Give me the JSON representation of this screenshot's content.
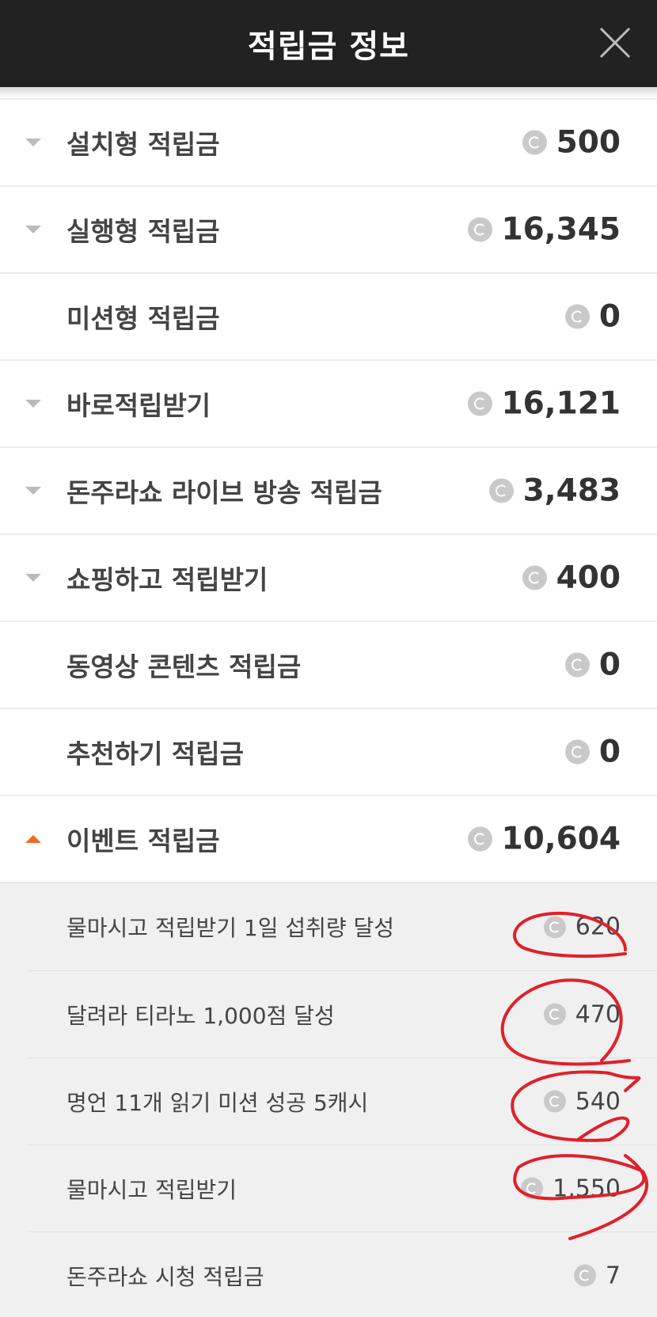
{
  "header": {
    "title": "적립금 정보",
    "close_icon": "close-icon"
  },
  "rows": [
    {
      "label": "설치형 적립금",
      "value": "500",
      "arrow": "down"
    },
    {
      "label": "실행형 적립금",
      "value": "16,345",
      "arrow": "down"
    },
    {
      "label": "미션형 적립금",
      "value": "0",
      "arrow": "none"
    },
    {
      "label": "바로적립받기",
      "value": "16,121",
      "arrow": "down"
    },
    {
      "label": "돈주라쇼 라이브 방송 적립금",
      "value": "3,483",
      "arrow": "down"
    },
    {
      "label": "쇼핑하고 적립받기",
      "value": "400",
      "arrow": "down"
    },
    {
      "label": "동영상 콘텐츠 적립금",
      "value": "0",
      "arrow": "none"
    },
    {
      "label": "추천하기 적립금",
      "value": "0",
      "arrow": "none"
    },
    {
      "label": "이벤트 적립금",
      "value": "10,604",
      "arrow": "up"
    }
  ],
  "event_items": [
    {
      "label": "물마시고 적립받기 1일 섭취량 달성",
      "value": "620"
    },
    {
      "label": "달려라 티라노 1,000점 달성",
      "value": "470"
    },
    {
      "label": "명언 11개 읽기 미션 성공 5캐시",
      "value": "540"
    },
    {
      "label": "물마시고 적립받기",
      "value": "1,550"
    },
    {
      "label": "돈주라쇼 시청 적립금",
      "value": "7"
    }
  ],
  "colors": {
    "header_bg": "#222222",
    "arrow_gray": "#bbbbbb",
    "arrow_orange": "#f26b1d",
    "annotation_red": "#e0202a"
  },
  "icons": {
    "coin": "coin-icon",
    "expand": "chevron-down-icon",
    "collapse": "chevron-up-icon"
  }
}
